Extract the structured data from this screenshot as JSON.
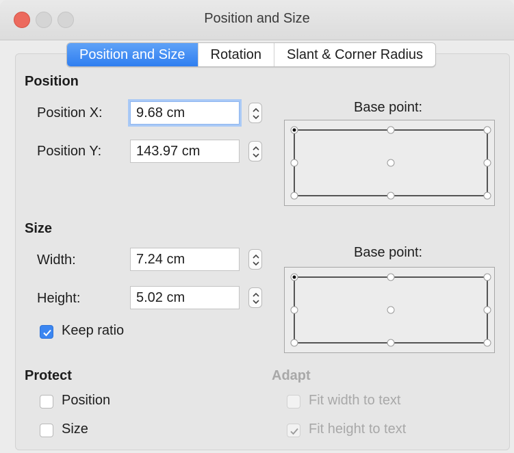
{
  "window": {
    "title": "Position and Size"
  },
  "tabs": [
    {
      "label": "Position and Size",
      "active": true
    },
    {
      "label": "Rotation",
      "active": false
    },
    {
      "label": "Slant & Corner Radius",
      "active": false
    }
  ],
  "position": {
    "title": "Position",
    "x_label": "Position X:",
    "x_value": "9.68 cm",
    "y_label": "Position Y:",
    "y_value": "143.97 cm",
    "base_point_label": "Base point:",
    "base_point_selected": "top-left"
  },
  "size": {
    "title": "Size",
    "width_label": "Width:",
    "width_value": "7.24 cm",
    "height_label": "Height:",
    "height_value": "5.02 cm",
    "keep_ratio_label": "Keep ratio",
    "keep_ratio_checked": true,
    "base_point_label": "Base point:",
    "base_point_selected": "top-left"
  },
  "protect": {
    "title": "Protect",
    "position_label": "Position",
    "position_checked": false,
    "size_label": "Size",
    "size_checked": false
  },
  "adapt": {
    "title": "Adapt",
    "enabled": false,
    "fit_width_label": "Fit width to text",
    "fit_width_checked": false,
    "fit_height_label": "Fit height to text",
    "fit_height_checked": true
  },
  "colors": {
    "accent": "#3b86f1",
    "close": "#ec6a5e"
  }
}
